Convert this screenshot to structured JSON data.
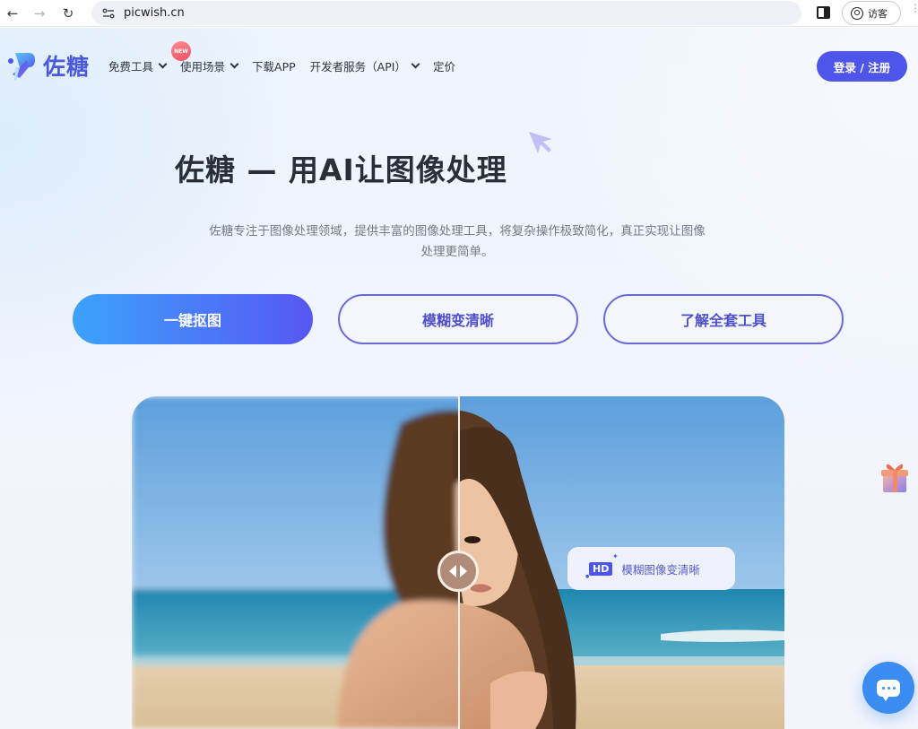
{
  "browser": {
    "url": "picwish.cn",
    "profile_label": "访客",
    "icons": [
      "back-arrow-icon",
      "forward-arrow-icon",
      "reload-icon",
      "site-info-icon",
      "side-panel-icon",
      "profile-icon",
      "more-menu-icon"
    ]
  },
  "header": {
    "logo_text": "佐糖",
    "nav": [
      {
        "label": "免费工具",
        "has_dropdown": true,
        "badge": "NEW"
      },
      {
        "label": "使用场景",
        "has_dropdown": true
      },
      {
        "label": "下载APP",
        "has_dropdown": false
      },
      {
        "label": "开发者服务（API）",
        "has_dropdown": true
      },
      {
        "label": "定价",
        "has_dropdown": false
      }
    ],
    "login_label": "登录 / 注册"
  },
  "hero": {
    "title": "佐糖 — 用AI让图像处理",
    "description": "佐糖专注于图像处理领域，提供丰富的图像处理工具，将复杂操作极致简化，真正实现让图像处理更简单。",
    "buttons": [
      {
        "label": "一键抠图",
        "style": "primary"
      },
      {
        "label": "模糊变清晰",
        "style": "outline"
      },
      {
        "label": "了解全套工具",
        "style": "outline"
      }
    ]
  },
  "comparison": {
    "badge": "HD",
    "label": "模糊图像变清晰",
    "split_position": 0.5
  },
  "floaters": {
    "gift_icon": "gift-icon",
    "chat_icon": "chat-icon"
  },
  "colors": {
    "brand": "#4d55ea",
    "gradient_start": "#3da2fb",
    "gradient_end": "#5657f4",
    "outline": "#6c68d8",
    "chat": "#3b8cf0"
  }
}
